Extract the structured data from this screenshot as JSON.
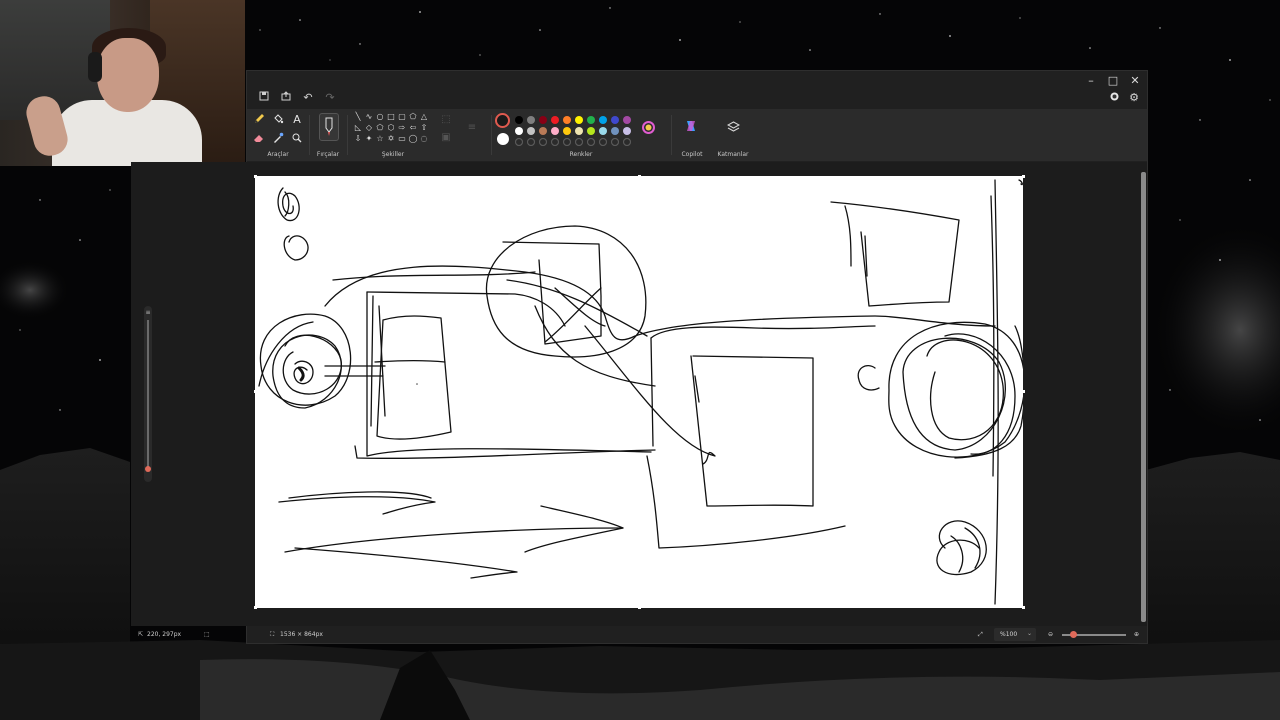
{
  "ribbon": {
    "groups": {
      "tools_label": "Araçlar",
      "brushes_label": "Fırçalar",
      "shapes_label": "Şekiller",
      "colors_label": "Renkler",
      "copilot_label": "Copilot",
      "layers_label": "Katmanlar"
    },
    "selected_color": "#1a1a1a",
    "secondary_color": "#ffffff",
    "palette_row1": [
      "#000000",
      "#7f7f7f",
      "#880015",
      "#ed1c24",
      "#ff7f27",
      "#fff200",
      "#22b14c",
      "#00a2e8",
      "#3f48cc",
      "#a349a4"
    ],
    "palette_row2": [
      "#ffffff",
      "#c3c3c3",
      "#b97a57",
      "#ffaec9",
      "#ffc90e",
      "#efe4b0",
      "#b5e61d",
      "#99d9ea",
      "#7092be",
      "#c8bfe7"
    ],
    "icons": {
      "pencil": "pencil-icon",
      "fill": "fill-bucket-icon",
      "text": "text-icon",
      "eraser": "eraser-icon",
      "picker": "color-picker-icon",
      "magnifier": "magnifier-icon"
    }
  },
  "titlebar": {
    "minimize": "–",
    "maximize": "□",
    "close": "✕"
  },
  "status": {
    "cursor_position": "220, 297px",
    "canvas_size": "1536 × 864px",
    "zoom_value": "%100"
  }
}
